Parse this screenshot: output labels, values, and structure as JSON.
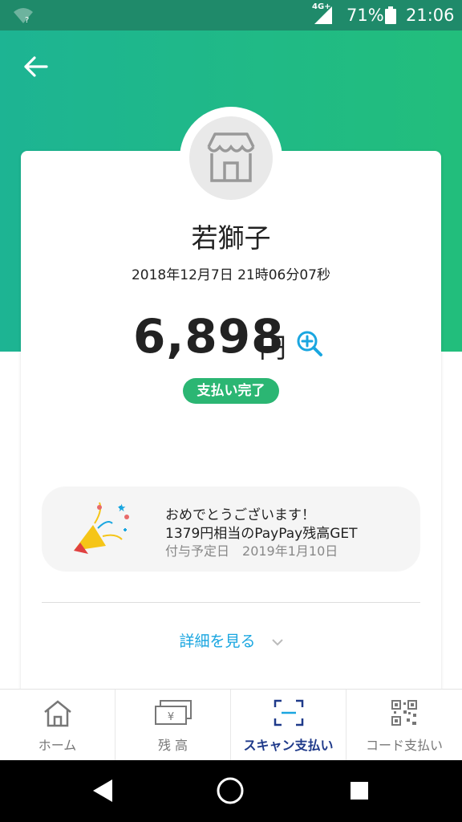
{
  "status_bar": {
    "network": "4G+",
    "battery_percent": "71%",
    "time": "21:06"
  },
  "merchant": {
    "name": "若獅子",
    "datetime": "2018年12月7日 21時06分07秒"
  },
  "payment": {
    "amount": "6,898",
    "currency": "円",
    "status": "支払い完了"
  },
  "promo": {
    "line1": "おめでとうございます！",
    "line2": "1379円相当のPayPay残高GET",
    "date_label": "付与予定日",
    "date_value": "2019年1月10日"
  },
  "details_link": "詳細を見る",
  "tabs": [
    {
      "label": "ホーム",
      "icon": "home-icon"
    },
    {
      "label": "残 高",
      "icon": "balance-icon"
    },
    {
      "label": "スキャン支払い",
      "icon": "scan-icon"
    },
    {
      "label": "コード支払い",
      "icon": "qr-code-icon"
    }
  ],
  "colors": {
    "accent_green": "#22be7c",
    "badge_green": "#2bb673",
    "link_blue": "#1aa6e0",
    "active_tab": "#1f3a8a"
  }
}
